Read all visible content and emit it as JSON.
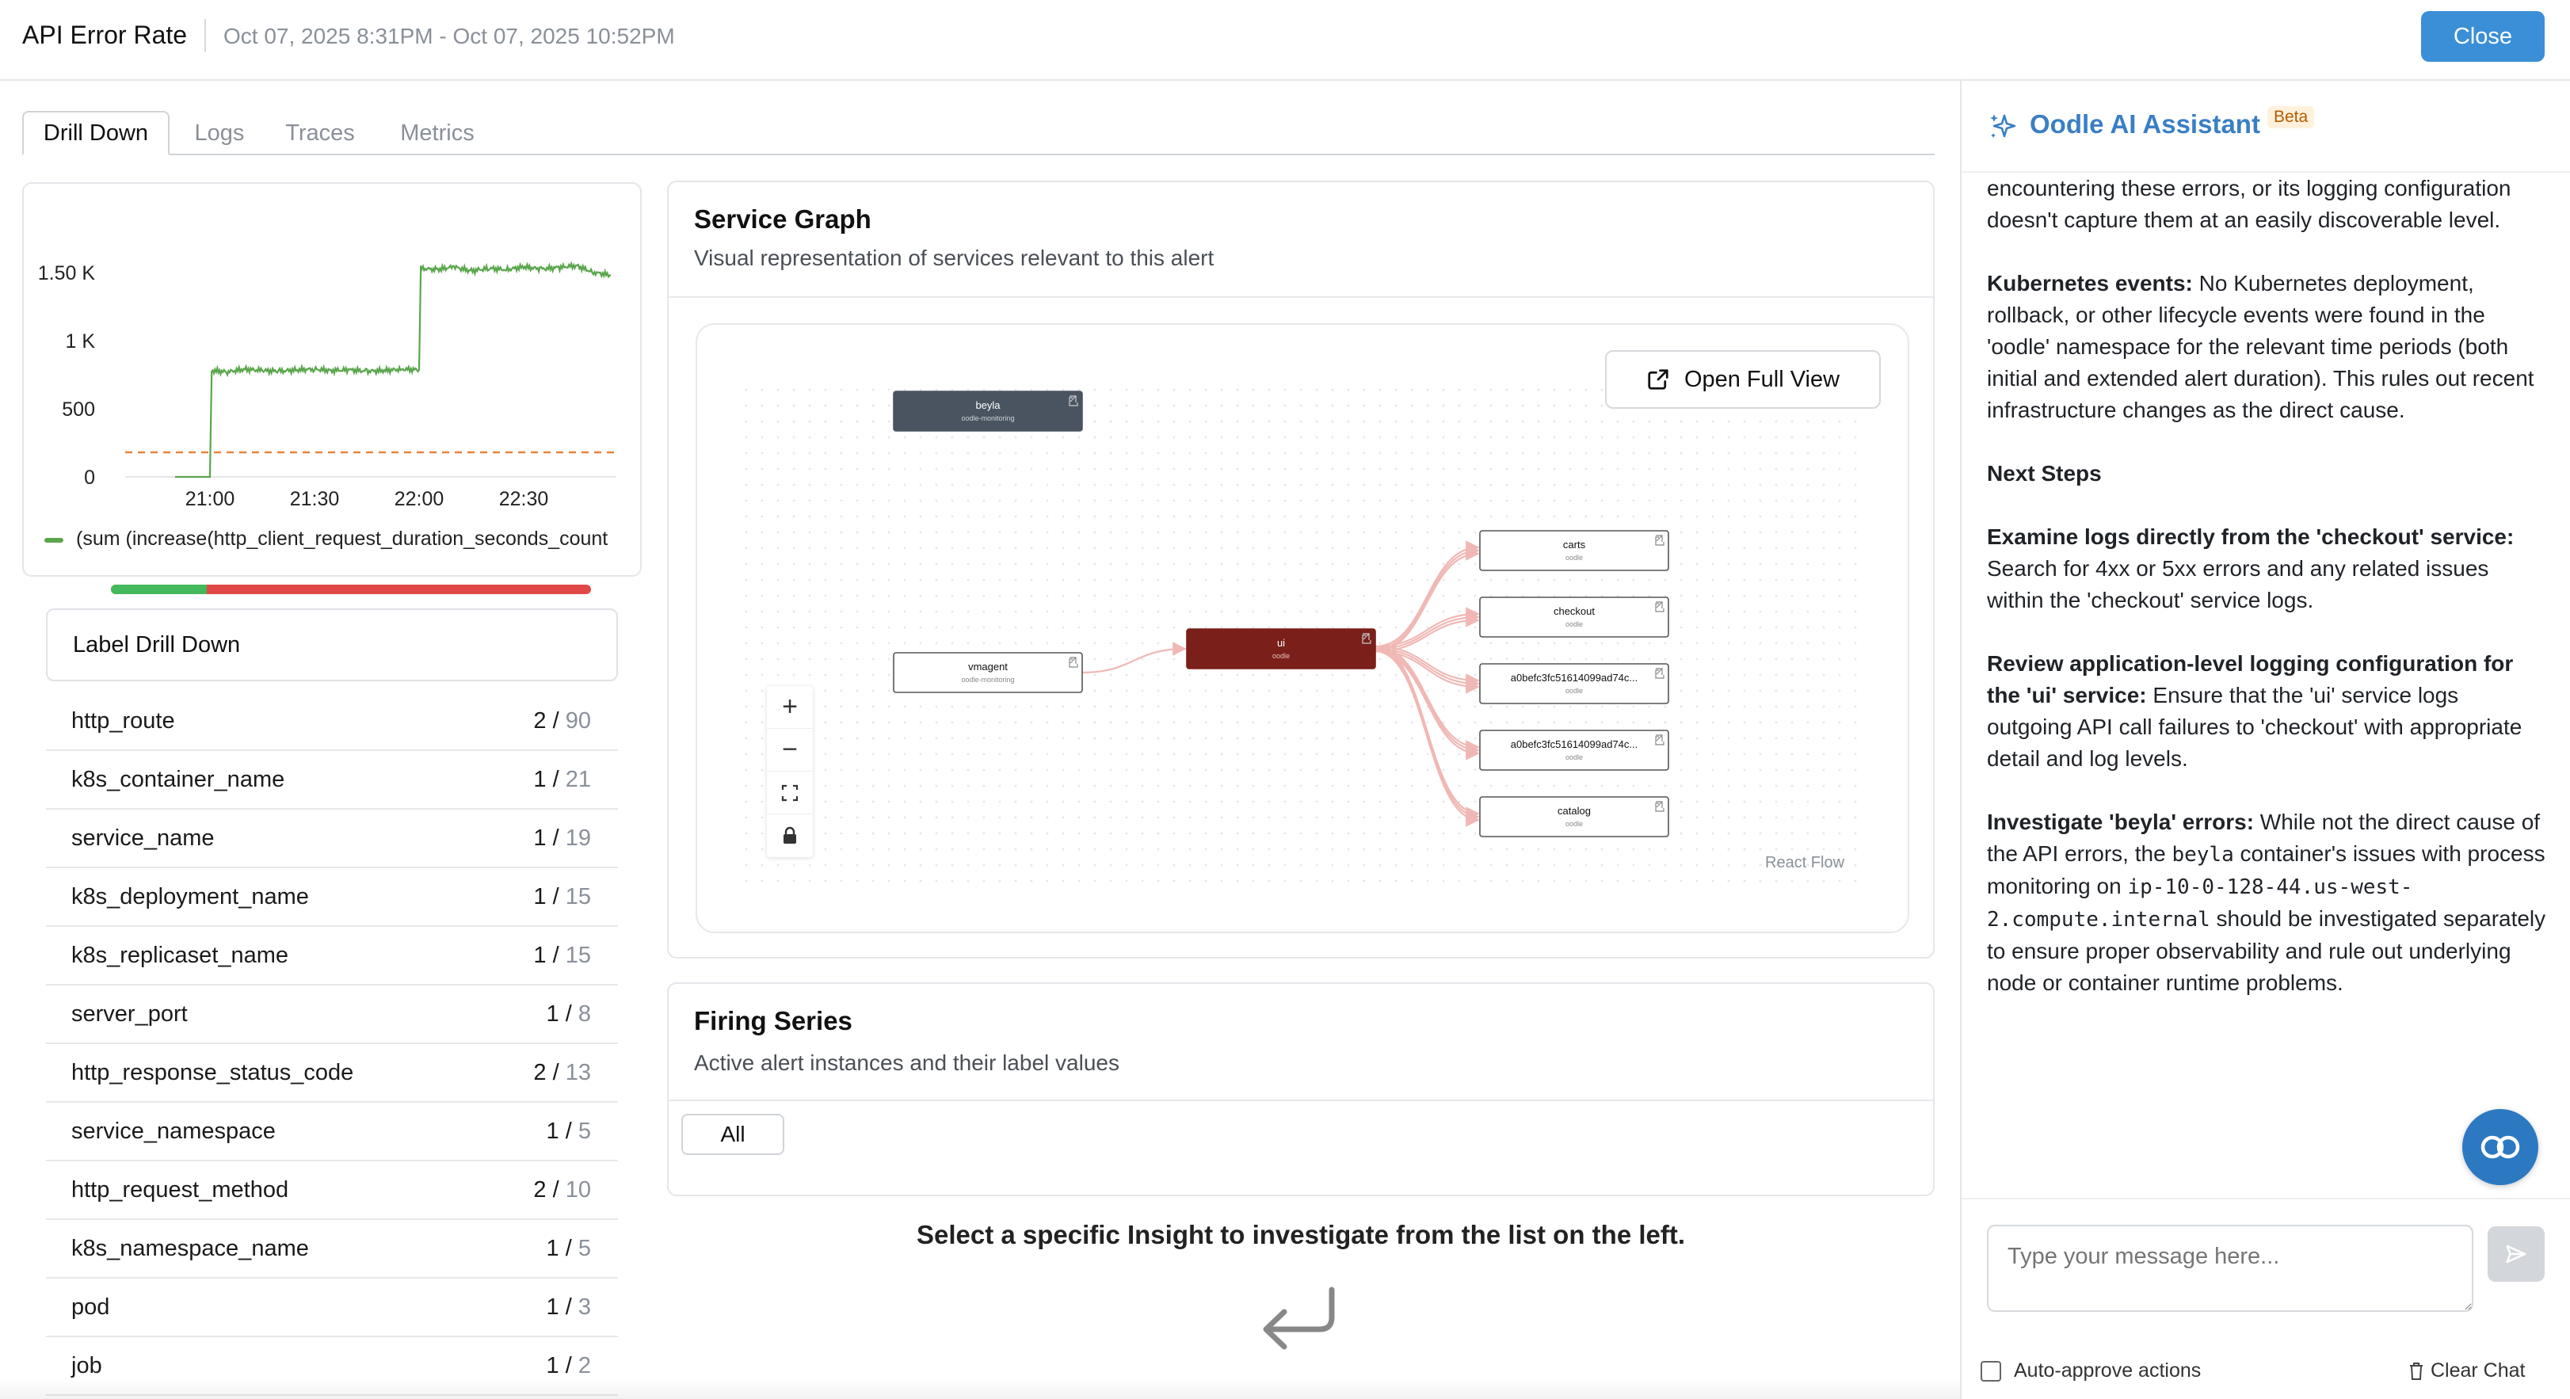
{
  "header": {
    "title": "API Error Rate",
    "time_range": "Oct 07, 2025 8:31PM - Oct 07, 2025 10:52PM",
    "close_label": "Close"
  },
  "tabs": [
    {
      "label": "Drill Down",
      "active": true
    },
    {
      "label": "Logs",
      "active": false
    },
    {
      "label": "Traces",
      "active": false
    },
    {
      "label": "Metrics",
      "active": false
    }
  ],
  "chart_data": {
    "type": "line",
    "x_ticks": [
      "21:00",
      "21:30",
      "22:00",
      "22:30"
    ],
    "y_ticks": [
      "0",
      "500",
      "1 K",
      "1.50 K"
    ],
    "ylim": [
      0,
      1650
    ],
    "series": [
      {
        "name": "(sum (increase(http_client_request_duration_seconds_count",
        "color": "#5aa64c",
        "x_minutes": [
          -10,
          0,
          0.5,
          5,
          10,
          15,
          20,
          25,
          30,
          35,
          40,
          45,
          50,
          55,
          60,
          60.5,
          65,
          70,
          75,
          80,
          85,
          90,
          95,
          100,
          105,
          110,
          115
        ],
        "values": [
          0,
          0,
          780,
          770,
          790,
          780,
          775,
          785,
          790,
          780,
          785,
          775,
          780,
          790,
          785,
          1530,
          1520,
          1540,
          1510,
          1530,
          1520,
          1540,
          1525,
          1535,
          1550,
          1500,
          1480
        ]
      }
    ],
    "threshold": {
      "value": 180,
      "color": "#e8843c",
      "style": "dashed"
    },
    "x_origin_label": "21:00",
    "grid": false
  },
  "progress": {
    "success_fraction": 0.2,
    "success_color": "#43b95b",
    "failure_color": "#e04848"
  },
  "label_drill_down": {
    "title": "Label Drill Down",
    "rows": [
      {
        "label": "http_route",
        "selected": "2",
        "total": "90"
      },
      {
        "label": "k8s_container_name",
        "selected": "1",
        "total": "21"
      },
      {
        "label": "service_name",
        "selected": "1",
        "total": "19"
      },
      {
        "label": "k8s_deployment_name",
        "selected": "1",
        "total": "15"
      },
      {
        "label": "k8s_replicaset_name",
        "selected": "1",
        "total": "15"
      },
      {
        "label": "server_port",
        "selected": "1",
        "total": "8"
      },
      {
        "label": "http_response_status_code",
        "selected": "2",
        "total": "13"
      },
      {
        "label": "service_namespace",
        "selected": "1",
        "total": "5"
      },
      {
        "label": "http_request_method",
        "selected": "2",
        "total": "10"
      },
      {
        "label": "k8s_namespace_name",
        "selected": "1",
        "total": "5"
      },
      {
        "label": "pod",
        "selected": "1",
        "total": "3"
      },
      {
        "label": "job",
        "selected": "1",
        "total": "2"
      }
    ]
  },
  "service_graph": {
    "title": "Service Graph",
    "subtitle": "Visual representation of services relevant to this alert",
    "open_full_label": "Open Full View",
    "attribution": "React Flow",
    "nodes": [
      {
        "id": "beyla",
        "label": "beyla",
        "namespace": "oodle-monitoring",
        "style": "dark"
      },
      {
        "id": "vmagent",
        "label": "vmagent",
        "namespace": "oodle-monitoring",
        "style": "light"
      },
      {
        "id": "ui",
        "label": "ui",
        "namespace": "oodle",
        "style": "alert"
      },
      {
        "id": "carts",
        "label": "carts",
        "namespace": "oodle",
        "style": "light"
      },
      {
        "id": "checkout",
        "label": "checkout",
        "namespace": "oodle",
        "style": "light"
      },
      {
        "id": "a0befc1",
        "label": "a0befc3fc51614099ad74c...",
        "namespace": "oodle",
        "style": "light"
      },
      {
        "id": "a0befc2",
        "label": "a0befc3fc51614099ad74c...",
        "namespace": "oodle",
        "style": "light"
      },
      {
        "id": "catalog",
        "label": "catalog",
        "namespace": "oodle",
        "style": "light"
      }
    ],
    "colors": {
      "dark_node": "#4a5461",
      "alert_node": "#7a1f1a",
      "edge": "#f0b8b4"
    }
  },
  "firing_series": {
    "title": "Firing Series",
    "subtitle": "Active alert instances and their label values",
    "filter_label": "All"
  },
  "select_insight_text": "Select a specific Insight to investigate from the list on the left.",
  "assistant": {
    "title": "Oodle AI Assistant",
    "badge": "Beta",
    "paragraphs": [
      {
        "parts": [
          {
            "t": "period. This suggests either the 'ui' service isn't encountering these errors, or its logging configuration doesn't capture them at an easily discoverable level."
          }
        ]
      },
      {
        "parts": [
          {
            "b": "Kubernetes events:"
          },
          {
            "t": " No Kubernetes deployment, rollback, or other lifecycle events were found in the 'oodle' namespace for the relevant time periods (both initial and extended alert duration). This rules out recent infrastructure changes as the direct cause."
          }
        ]
      },
      {
        "parts": [
          {
            "b": "Next Steps"
          }
        ]
      },
      {
        "parts": [
          {
            "b": "Examine logs directly from the 'checkout' service:"
          },
          {
            "t": " Search for 4xx or 5xx errors and any related issues within the 'checkout' service logs."
          }
        ]
      },
      {
        "parts": [
          {
            "b": "Review application-level logging configuration for the 'ui' service:"
          },
          {
            "t": " Ensure that the 'ui' service logs outgoing API call failures to 'checkout' with appropriate detail and log levels."
          }
        ]
      },
      {
        "parts": [
          {
            "b": "Investigate 'beyla' errors:"
          },
          {
            "t": " While not the direct cause of the API errors, the "
          },
          {
            "c": "beyla"
          },
          {
            "t": " container's issues with process monitoring on "
          },
          {
            "c": "ip-10-0-128-44.us-west-2.compute.internal"
          },
          {
            "t": " should be investigated separately to ensure proper observability and rule out underlying node or container runtime problems."
          }
        ]
      }
    ],
    "input_placeholder": "Type your message here...",
    "auto_approve_label": "Auto-approve actions",
    "clear_chat_label": "Clear Chat"
  }
}
